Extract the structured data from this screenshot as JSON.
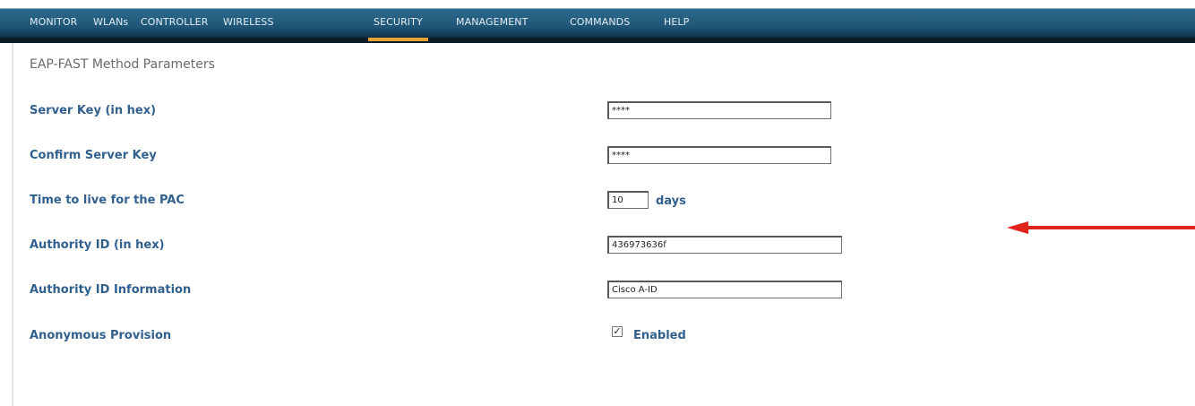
{
  "nav": {
    "items": [
      {
        "label": "MONITOR"
      },
      {
        "label": "WLANs"
      },
      {
        "label": "CONTROLLER"
      },
      {
        "label": "WIRELESS"
      },
      {
        "label": "SECURITY",
        "active": true
      },
      {
        "label": "MANAGEMENT"
      },
      {
        "label": "COMMANDS"
      },
      {
        "label": "HELP"
      }
    ]
  },
  "page": {
    "title": "EAP-FAST Method Parameters"
  },
  "form": {
    "server_key": {
      "label": "Server Key (in hex)",
      "value": "****"
    },
    "confirm_server_key": {
      "label": "Confirm Server Key",
      "value": "****"
    },
    "pac_ttl": {
      "label": "Time to live for the PAC",
      "value": "10",
      "unit": "days"
    },
    "authority_id": {
      "label": "Authority ID (in hex)",
      "value": "436973636f"
    },
    "authority_id_info": {
      "label": "Authority ID Information",
      "value": "Cisco A-ID"
    },
    "anonymous_provision": {
      "label": "Anonymous Provision",
      "checkbox_label": "Enabled",
      "checked": true,
      "check_mark": "✓"
    }
  },
  "colors": {
    "nav_bar": "#1f5676",
    "active_underline": "#e8a235",
    "label_blue": "#31608f",
    "arrow_red": "#e0231b"
  },
  "annotation": {
    "arrow_icon": "left-arrow-icon"
  }
}
